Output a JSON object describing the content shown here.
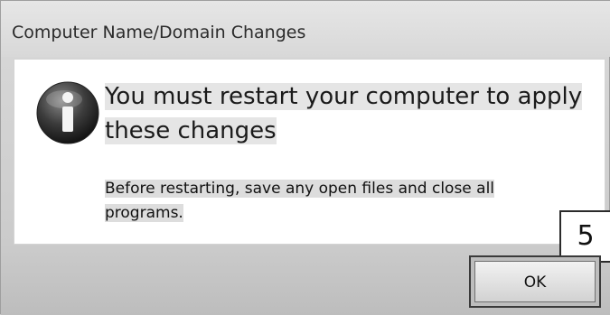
{
  "dialog": {
    "title": "Computer Name/Domain Changes",
    "icon": "information-icon",
    "main_instruction": "You must restart your computer to apply these changes",
    "secondary_text": "Before restarting, save any open files and close all programs.",
    "step_badge": "5",
    "ok_label": "OK"
  }
}
